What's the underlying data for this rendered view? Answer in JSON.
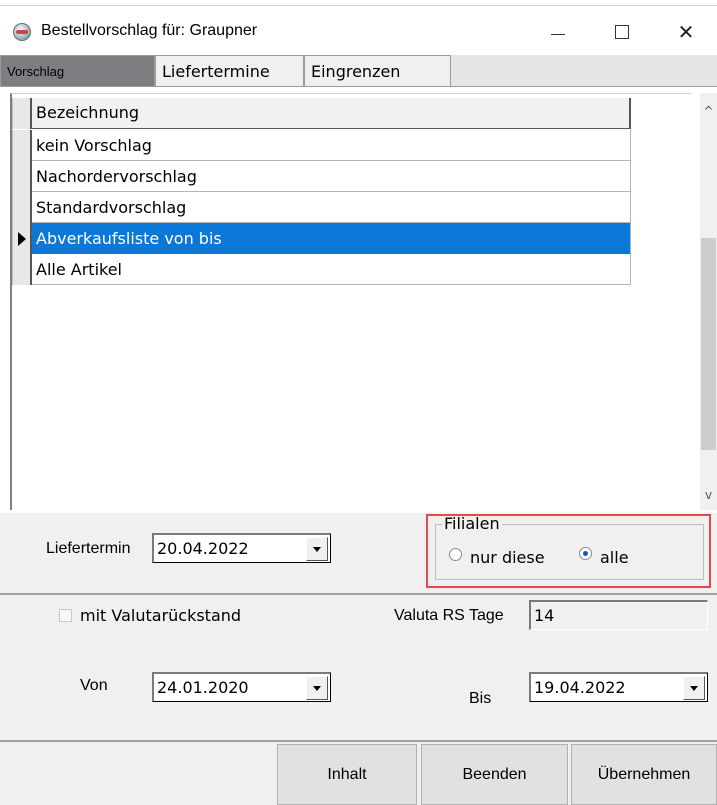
{
  "window": {
    "title": "Bestellvorschlag für: Graupner",
    "icon": "app-icon",
    "controls": {
      "minimize": "minimize-icon",
      "maximize": "maximize-icon",
      "close": "close-icon"
    }
  },
  "tabs": [
    {
      "label": "Vorschlag",
      "active": true
    },
    {
      "label": "Liefertermine",
      "active": false
    },
    {
      "label": "Eingrenzen",
      "active": false
    }
  ],
  "grid": {
    "header": "Bezeichnung",
    "rows": [
      {
        "label": "kein Vorschlag",
        "selected": false
      },
      {
        "label": "Nachordervorschlag",
        "selected": false
      },
      {
        "label": "Standardvorschlag",
        "selected": false
      },
      {
        "label": "Abverkaufsliste von bis",
        "selected": true
      },
      {
        "label": "Alle Artikel",
        "selected": false
      }
    ]
  },
  "scrollbar": {
    "up": "^",
    "down": "v"
  },
  "liefertermin": {
    "label": "Liefertermin",
    "value": "20.04.2022"
  },
  "filialen": {
    "title": "Filialen",
    "options": [
      {
        "label": "nur diese",
        "checked": false
      },
      {
        "label": "alle",
        "checked": true
      }
    ]
  },
  "valuta": {
    "checkbox_label": "mit Valutarückstand",
    "checked": false,
    "rs_tage_label": "Valuta RS Tage",
    "rs_tage_value": "14"
  },
  "von": {
    "label": "Von",
    "value": "24.01.2020"
  },
  "bis": {
    "label": "Bis",
    "value": "19.04.2022"
  },
  "buttons": {
    "inhalt": "Inhalt",
    "beenden": "Beenden",
    "uebernehmen": "Übernehmen"
  },
  "colors": {
    "selection": "#0b78d7",
    "active_tab": "#7f7d82",
    "highlight_box": "#e04b4b",
    "panel_bg": "#f0f0f0"
  }
}
